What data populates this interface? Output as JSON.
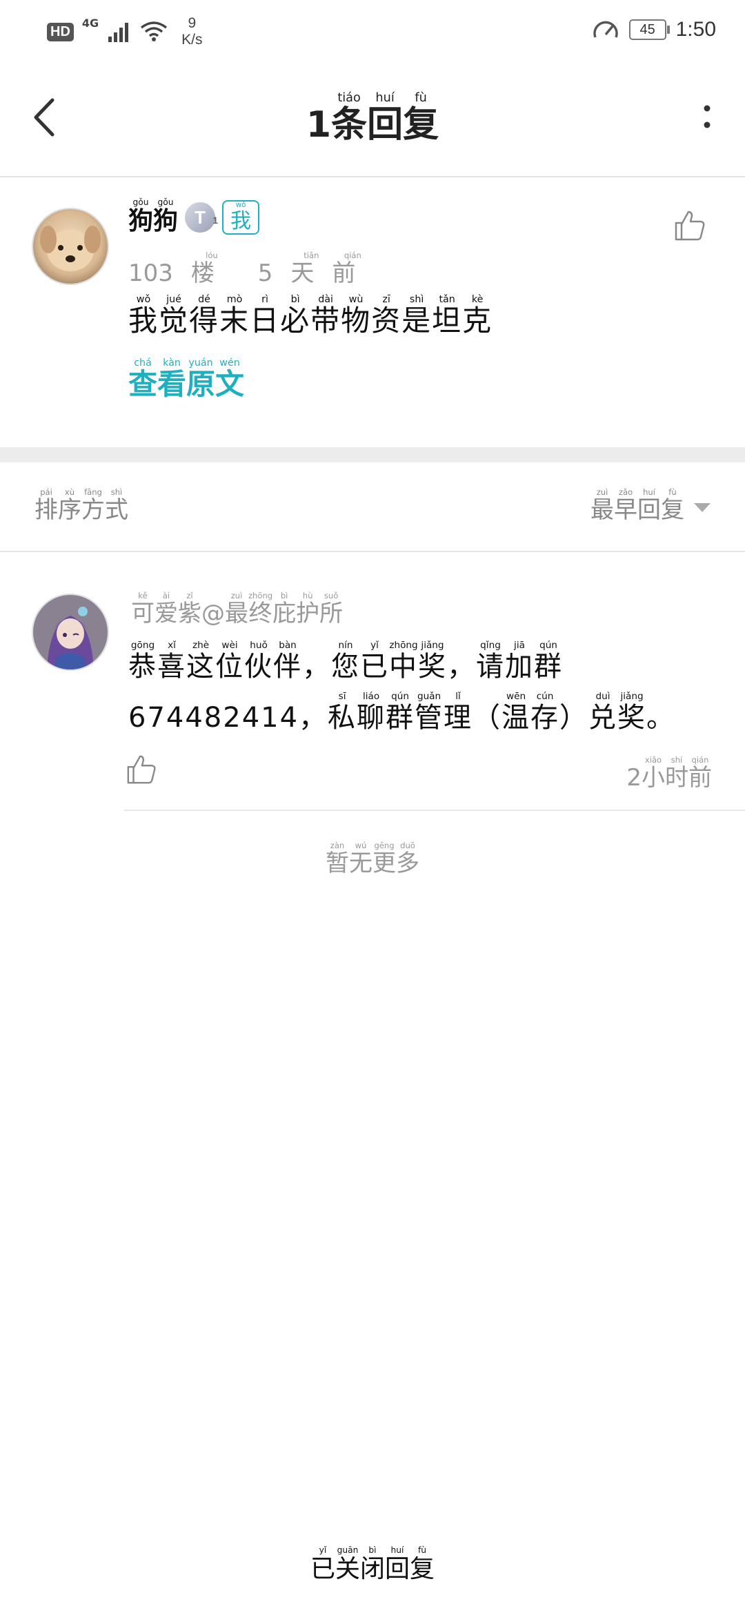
{
  "status_bar": {
    "hd": "HD",
    "network": "4G",
    "speed_value": "9",
    "speed_unit": "K/s",
    "battery": "45",
    "time": "1:50"
  },
  "header": {
    "title_num": "1",
    "title_chars": [
      {
        "c": "条",
        "p": "tiáo"
      },
      {
        "c": "回",
        "p": "huí"
      },
      {
        "c": "复",
        "p": "fù"
      }
    ],
    "back_icon": "chevron-left-icon",
    "more_icon": "more-vertical-icon"
  },
  "post": {
    "name_chars": [
      {
        "c": "狗",
        "p": "gǒu"
      },
      {
        "c": "狗",
        "p": "gǒu"
      }
    ],
    "level_badge": "T",
    "level_sub": "1",
    "me_badge": {
      "c": "我",
      "p": "wǒ"
    },
    "floor_num": "103",
    "floor_char": {
      "c": "楼",
      "p": "lóu"
    },
    "time_num": "5",
    "time_chars": [
      {
        "c": "天",
        "p": "tiān"
      },
      {
        "c": "前",
        "p": "qián"
      }
    ],
    "content_chars": [
      {
        "c": "我",
        "p": "wǒ"
      },
      {
        "c": "觉",
        "p": "jué"
      },
      {
        "c": "得",
        "p": "dé"
      },
      {
        "c": "末",
        "p": "mò"
      },
      {
        "c": "日",
        "p": "rì"
      },
      {
        "c": "必",
        "p": "bì"
      },
      {
        "c": "带",
        "p": "dài"
      },
      {
        "c": "物",
        "p": "wù"
      },
      {
        "c": "资",
        "p": "zī"
      },
      {
        "c": "是",
        "p": "shì"
      },
      {
        "c": "坦",
        "p": "tǎn"
      },
      {
        "c": "克",
        "p": "kè"
      }
    ],
    "view_original_chars": [
      {
        "c": "查",
        "p": "chá"
      },
      {
        "c": "看",
        "p": "kàn"
      },
      {
        "c": "原",
        "p": "yuán"
      },
      {
        "c": "文",
        "p": "wén"
      }
    ],
    "like_icon": "thumbs-up-icon"
  },
  "sort": {
    "label_chars": [
      {
        "c": "排",
        "p": "pái"
      },
      {
        "c": "序",
        "p": "xù"
      },
      {
        "c": "方",
        "p": "fāng"
      },
      {
        "c": "式",
        "p": "shì"
      }
    ],
    "selected_chars": [
      {
        "c": "最",
        "p": "zuì"
      },
      {
        "c": "早",
        "p": "zǎo"
      },
      {
        "c": "回",
        "p": "huí"
      },
      {
        "c": "复",
        "p": "fù"
      }
    ],
    "caret_icon": "caret-down-icon"
  },
  "reply": {
    "author_prefix_chars": [
      {
        "c": "可",
        "p": "kě"
      },
      {
        "c": "爱",
        "p": "ài"
      },
      {
        "c": "紫",
        "p": "zǐ"
      }
    ],
    "author_at": "@",
    "author_suffix_chars": [
      {
        "c": "最",
        "p": "zuì"
      },
      {
        "c": "终",
        "p": "zhōng"
      },
      {
        "c": "庇",
        "p": "bì"
      },
      {
        "c": "护",
        "p": "hù"
      },
      {
        "c": "所",
        "p": "suǒ"
      }
    ],
    "line1_chars": [
      {
        "c": "恭",
        "p": "gōng"
      },
      {
        "c": "喜",
        "p": "xǐ"
      },
      {
        "c": "这",
        "p": "zhè"
      },
      {
        "c": "位",
        "p": "wèi"
      },
      {
        "c": "伙",
        "p": "huǒ"
      },
      {
        "c": "伴",
        "p": "bàn"
      },
      {
        "c": "，",
        "p": ""
      },
      {
        "c": "您",
        "p": "nín"
      },
      {
        "c": "已",
        "p": "yǐ"
      },
      {
        "c": "中",
        "p": "zhōng"
      },
      {
        "c": "奖",
        "p": "jiǎng"
      },
      {
        "c": "，",
        "p": ""
      },
      {
        "c": "请",
        "p": "qǐng"
      },
      {
        "c": "加",
        "p": "jiā"
      },
      {
        "c": "群",
        "p": "qún"
      }
    ],
    "line2_number": "674482414",
    "line2_chars": [
      {
        "c": "，",
        "p": ""
      },
      {
        "c": "私",
        "p": "sī"
      },
      {
        "c": "聊",
        "p": "liáo"
      },
      {
        "c": "群",
        "p": "qún"
      },
      {
        "c": "管",
        "p": "guǎn"
      },
      {
        "c": "理",
        "p": "lǐ"
      },
      {
        "c": "（",
        "p": ""
      },
      {
        "c": "温",
        "p": "wēn"
      },
      {
        "c": "存",
        "p": "cún"
      },
      {
        "c": "）",
        "p": ""
      },
      {
        "c": "兑",
        "p": "duì"
      },
      {
        "c": "奖",
        "p": "jiǎng"
      },
      {
        "c": "。",
        "p": ""
      }
    ],
    "time_num": "2",
    "time_chars": [
      {
        "c": "小",
        "p": "xiǎo"
      },
      {
        "c": "时",
        "p": "shí"
      },
      {
        "c": "前",
        "p": "qián"
      }
    ],
    "like_icon": "thumbs-up-icon"
  },
  "no_more_chars": [
    {
      "c": "暂",
      "p": "zàn"
    },
    {
      "c": "无",
      "p": "wú"
    },
    {
      "c": "更",
      "p": "gēng"
    },
    {
      "c": "多",
      "p": "duō"
    }
  ],
  "footer_chars": [
    {
      "c": "已",
      "p": "yǐ"
    },
    {
      "c": "关",
      "p": "guān"
    },
    {
      "c": "闭",
      "p": "bì"
    },
    {
      "c": "回",
      "p": "huí"
    },
    {
      "c": "复",
      "p": "fù"
    }
  ]
}
